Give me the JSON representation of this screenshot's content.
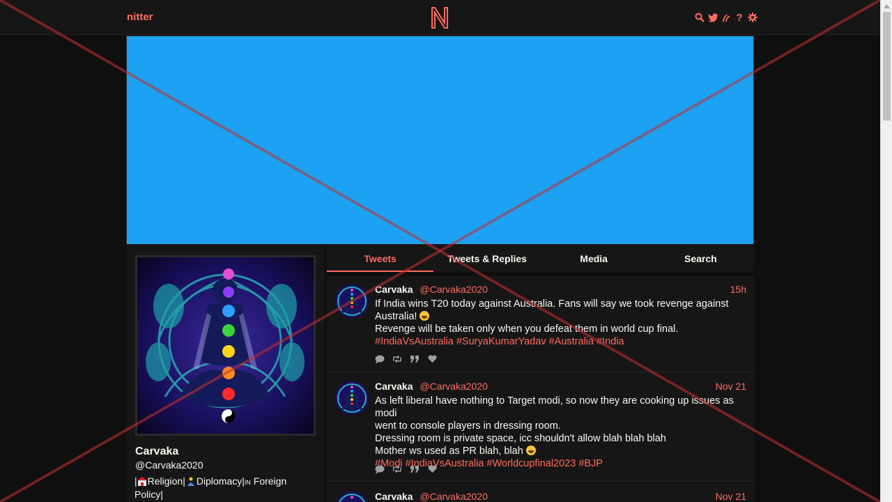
{
  "nav": {
    "brand": "nitter",
    "logo_icon": "nitter-logo-icon",
    "icons": [
      "search-icon",
      "twitter-icon",
      "rss-icon",
      "help-icon",
      "settings-icon"
    ],
    "help_glyph": "?",
    "accent": "#ff6c60"
  },
  "banner": {
    "color": "#1da1f2"
  },
  "profile": {
    "fullname": "Carvaka",
    "username": "@Carvaka2020",
    "bio_line1_a": "|",
    "bio_line1_b": "Religion|",
    "bio_line1_c": "Diplomacy|",
    "bio_line1_d": "IN",
    "bio_line1_e": " Foreign",
    "bio_line2": "Policy|"
  },
  "tabs": [
    {
      "label": "Tweets",
      "active": true
    },
    {
      "label": "Tweets & Replies",
      "active": false
    },
    {
      "label": "Media",
      "active": false
    },
    {
      "label": "Search",
      "active": false
    }
  ],
  "tweets": [
    {
      "fullname": "Carvaka",
      "username": "@Carvaka2020",
      "date": "15h",
      "line1": "If India wins T20 today against Australia. Fans will say we took revenge against",
      "line2": "Australia!",
      "line3": "Revenge will be taken only when you defeat them in world cup final.",
      "hashtags": "#IndiaVsAustralia #SuryaKumarYadav #Australia #India"
    },
    {
      "fullname": "Carvaka",
      "username": "@Carvaka2020",
      "date": "Nov 21",
      "line1": "As left liberal have nothing to Target modi, so now they are cooking up issues as modi",
      "line2": "went to console players in dressing room.",
      "line3": "Dressing room is private space, icc shouldn't allow blah blah blah",
      "line4": "Mother ws used as PR blah, blah",
      "hashtags": "#Modi #IndiaVsAustralia #Worldcupfinal2023 #BJP"
    },
    {
      "fullname": "Carvaka",
      "username": "@Carvaka2020",
      "date": "Nov 21"
    }
  ],
  "tweet_stat_icons": [
    "comment-icon",
    "retweet-icon",
    "quote-icon",
    "heart-icon"
  ]
}
